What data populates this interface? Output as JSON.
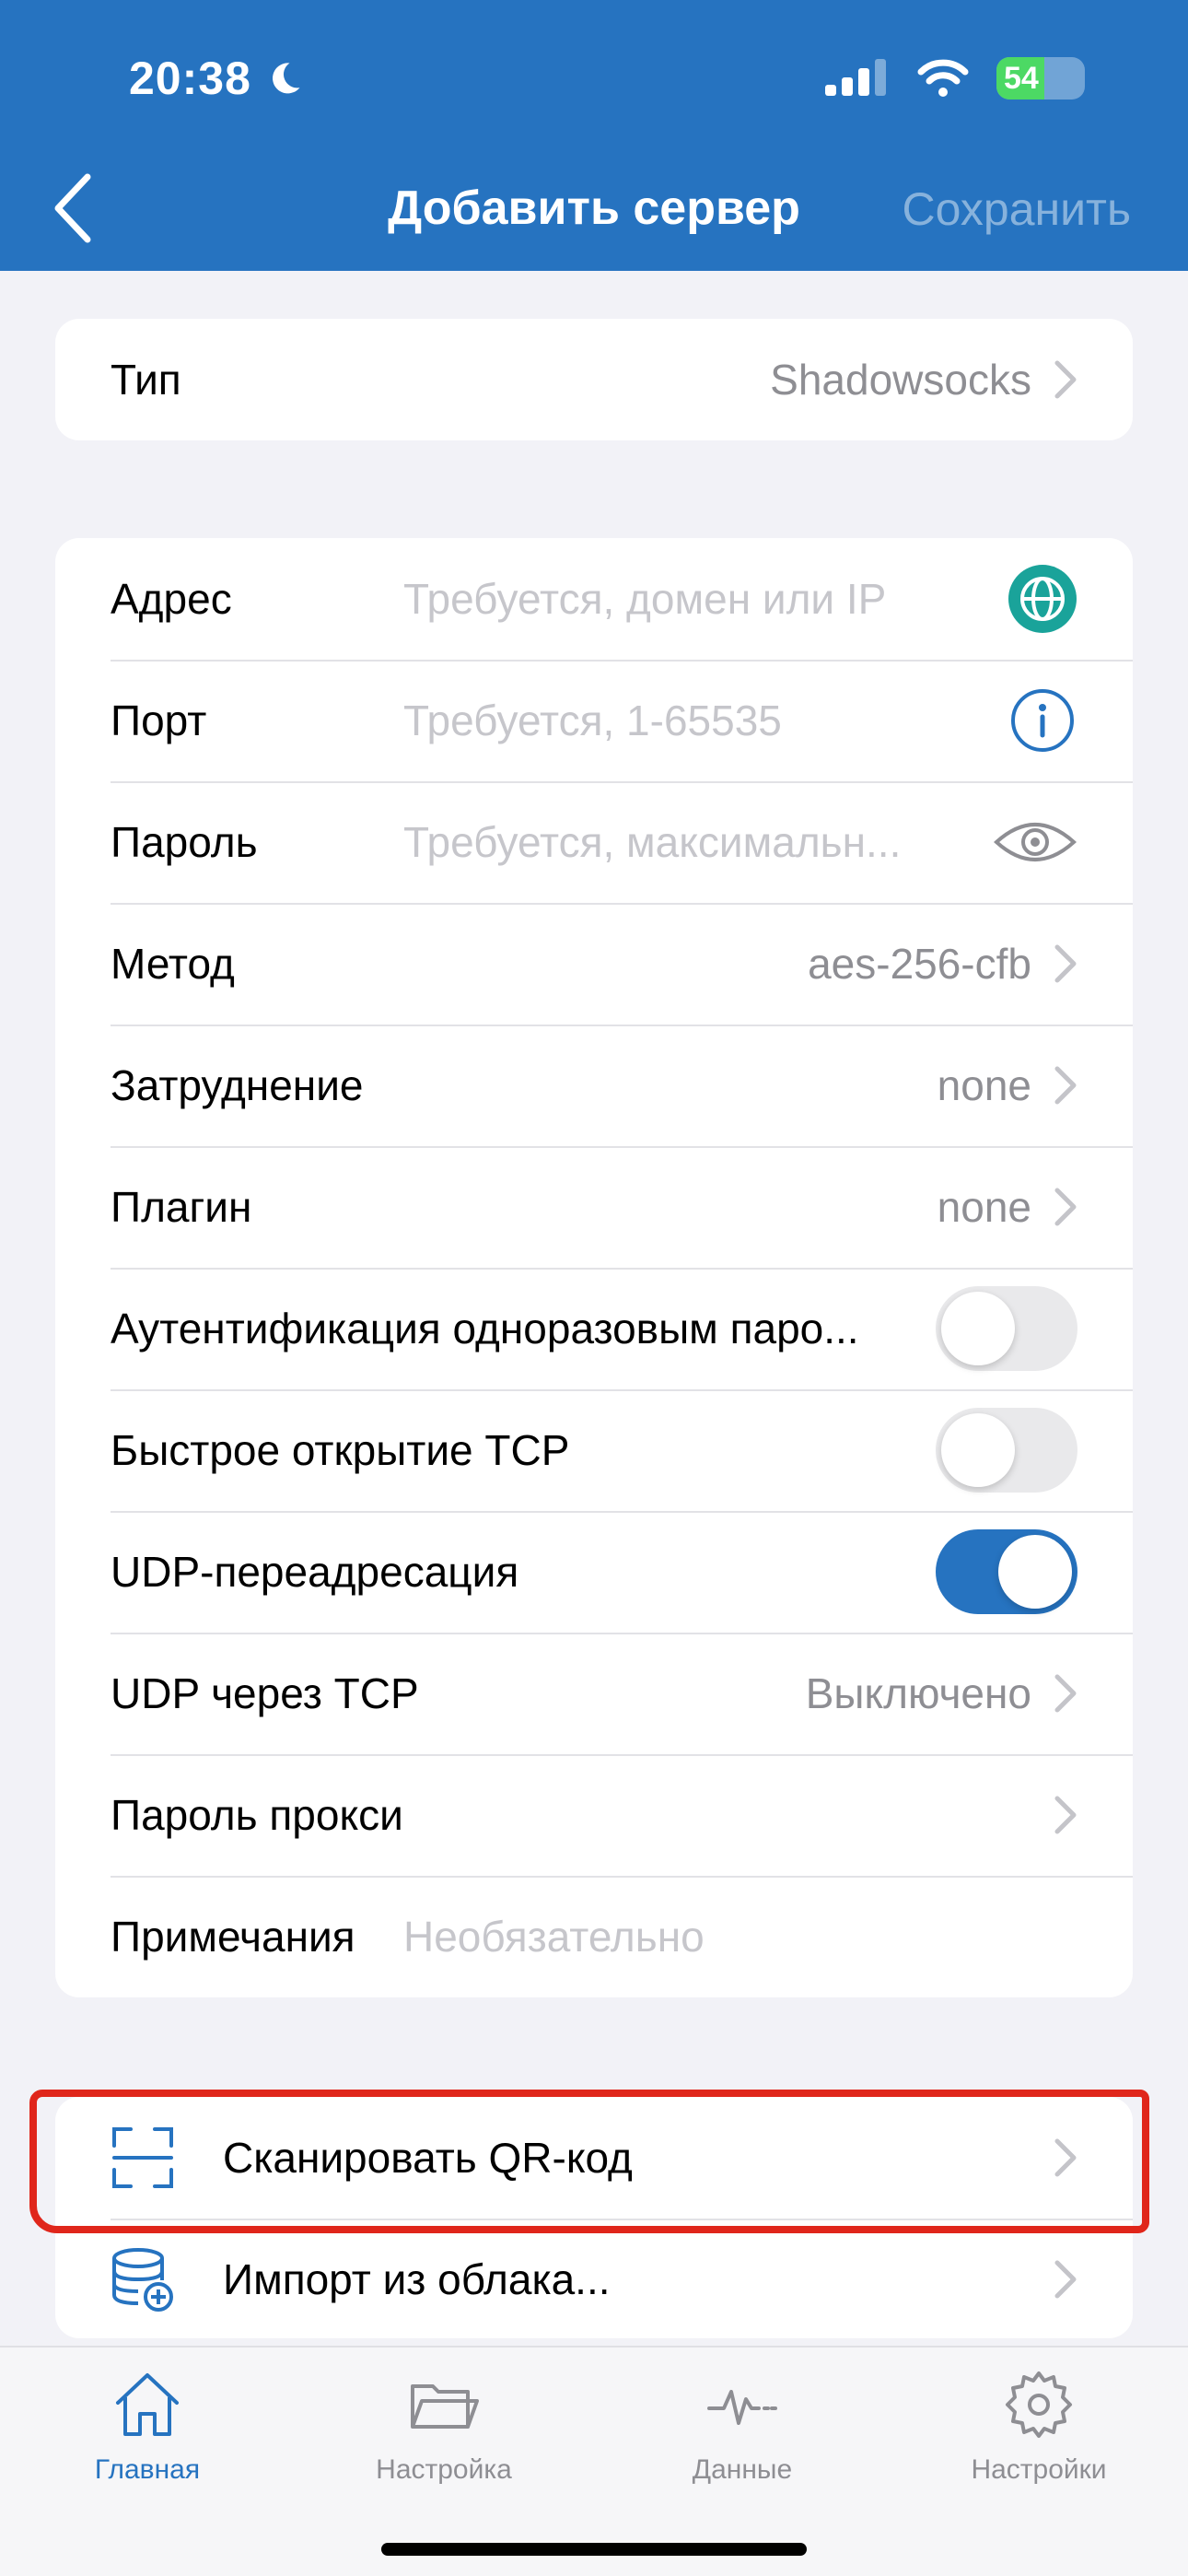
{
  "status_bar": {
    "time": "20:38",
    "battery": "54"
  },
  "nav": {
    "title": "Добавить сервер",
    "save_label": "Сохранить"
  },
  "type_row": {
    "label": "Тип",
    "value": "Shadowsocks"
  },
  "form": {
    "address": {
      "label": "Адрес",
      "placeholder": "Требуется, домен или IP"
    },
    "port": {
      "label": "Порт",
      "placeholder": "Требуется, 1-65535"
    },
    "password": {
      "label": "Пароль",
      "placeholder": "Требуется, максимальн..."
    },
    "method": {
      "label": "Метод",
      "value": "aes-256-cfb"
    },
    "obfs": {
      "label": "Затруднение",
      "value": "none"
    },
    "plugin": {
      "label": "Плагин",
      "value": "none"
    },
    "ota": {
      "label": "Аутентификация одноразовым паро...",
      "enabled": false
    },
    "tcp_fast_open": {
      "label": "Быстрое открытие TCP",
      "enabled": false
    },
    "udp_relay": {
      "label": "UDP-переадресация",
      "enabled": true
    },
    "udp_over_tcp": {
      "label": "UDP через TCP",
      "value": "Выключено"
    },
    "proxy_password": {
      "label": "Пароль прокси"
    },
    "notes": {
      "label": "Примечания",
      "placeholder": "Необязательно"
    }
  },
  "actions": {
    "scan_qr": {
      "label": "Сканировать QR-код"
    },
    "import_cloud": {
      "label": "Импорт из облака..."
    }
  },
  "tabbar": {
    "tabs": [
      {
        "label": "Главная",
        "icon": "home-icon",
        "active": true
      },
      {
        "label": "Настройка",
        "icon": "folder-icon",
        "active": false
      },
      {
        "label": "Данные",
        "icon": "activity-icon",
        "active": false
      },
      {
        "label": "Настройки",
        "icon": "gear-icon",
        "active": false
      }
    ]
  },
  "colors": {
    "accent": "#2673c0",
    "highlight": "#e0261b",
    "globe": "#1aa39a"
  }
}
